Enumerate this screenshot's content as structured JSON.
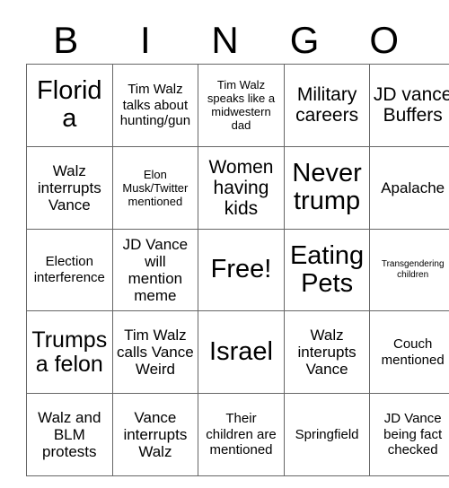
{
  "header": {
    "letters": [
      "B",
      "I",
      "N",
      "G",
      "O"
    ]
  },
  "grid": {
    "rows": [
      [
        {
          "text": "Florida",
          "size": "fs-xxl"
        },
        {
          "text": "Tim Walz talks about hunting/gun",
          "size": "fs-m"
        },
        {
          "text": "Tim Walz speaks like a midwestern dad",
          "size": "fs-s"
        },
        {
          "text": "Military careers",
          "size": "fs-l"
        },
        {
          "text": "JD vance Buffers",
          "size": "fs-l"
        }
      ],
      [
        {
          "text": "Walz interrupts Vance",
          "size": "fs-ml"
        },
        {
          "text": "Elon Musk/Twitter mentioned",
          "size": "fs-s"
        },
        {
          "text": "Women having kids",
          "size": "fs-l"
        },
        {
          "text": "Never trump",
          "size": "fs-xxl"
        },
        {
          "text": "Apalache",
          "size": "fs-ml"
        }
      ],
      [
        {
          "text": "Election interference",
          "size": "fs-m"
        },
        {
          "text": "JD Vance will mention meme",
          "size": "fs-ml"
        },
        {
          "text": "Free!",
          "size": "fs-xxl"
        },
        {
          "text": "Eating Pets",
          "size": "fs-xxl"
        },
        {
          "text": "Transgendering children",
          "size": "fs-xs"
        }
      ],
      [
        {
          "text": "Trumps a felon",
          "size": "fs-xl"
        },
        {
          "text": "Tim Walz calls Vance Weird",
          "size": "fs-ml"
        },
        {
          "text": "Israel",
          "size": "fs-xxl"
        },
        {
          "text": "Walz interupts Vance",
          "size": "fs-ml"
        },
        {
          "text": "Couch mentioned",
          "size": "fs-m"
        }
      ],
      [
        {
          "text": "Walz and BLM protests",
          "size": "fs-ml"
        },
        {
          "text": "Vance interrupts Walz",
          "size": "fs-ml"
        },
        {
          "text": "Their children are mentioned",
          "size": "fs-m"
        },
        {
          "text": "Springfield",
          "size": "fs-m"
        },
        {
          "text": "JD Vance being fact checked",
          "size": "fs-m"
        }
      ]
    ]
  }
}
